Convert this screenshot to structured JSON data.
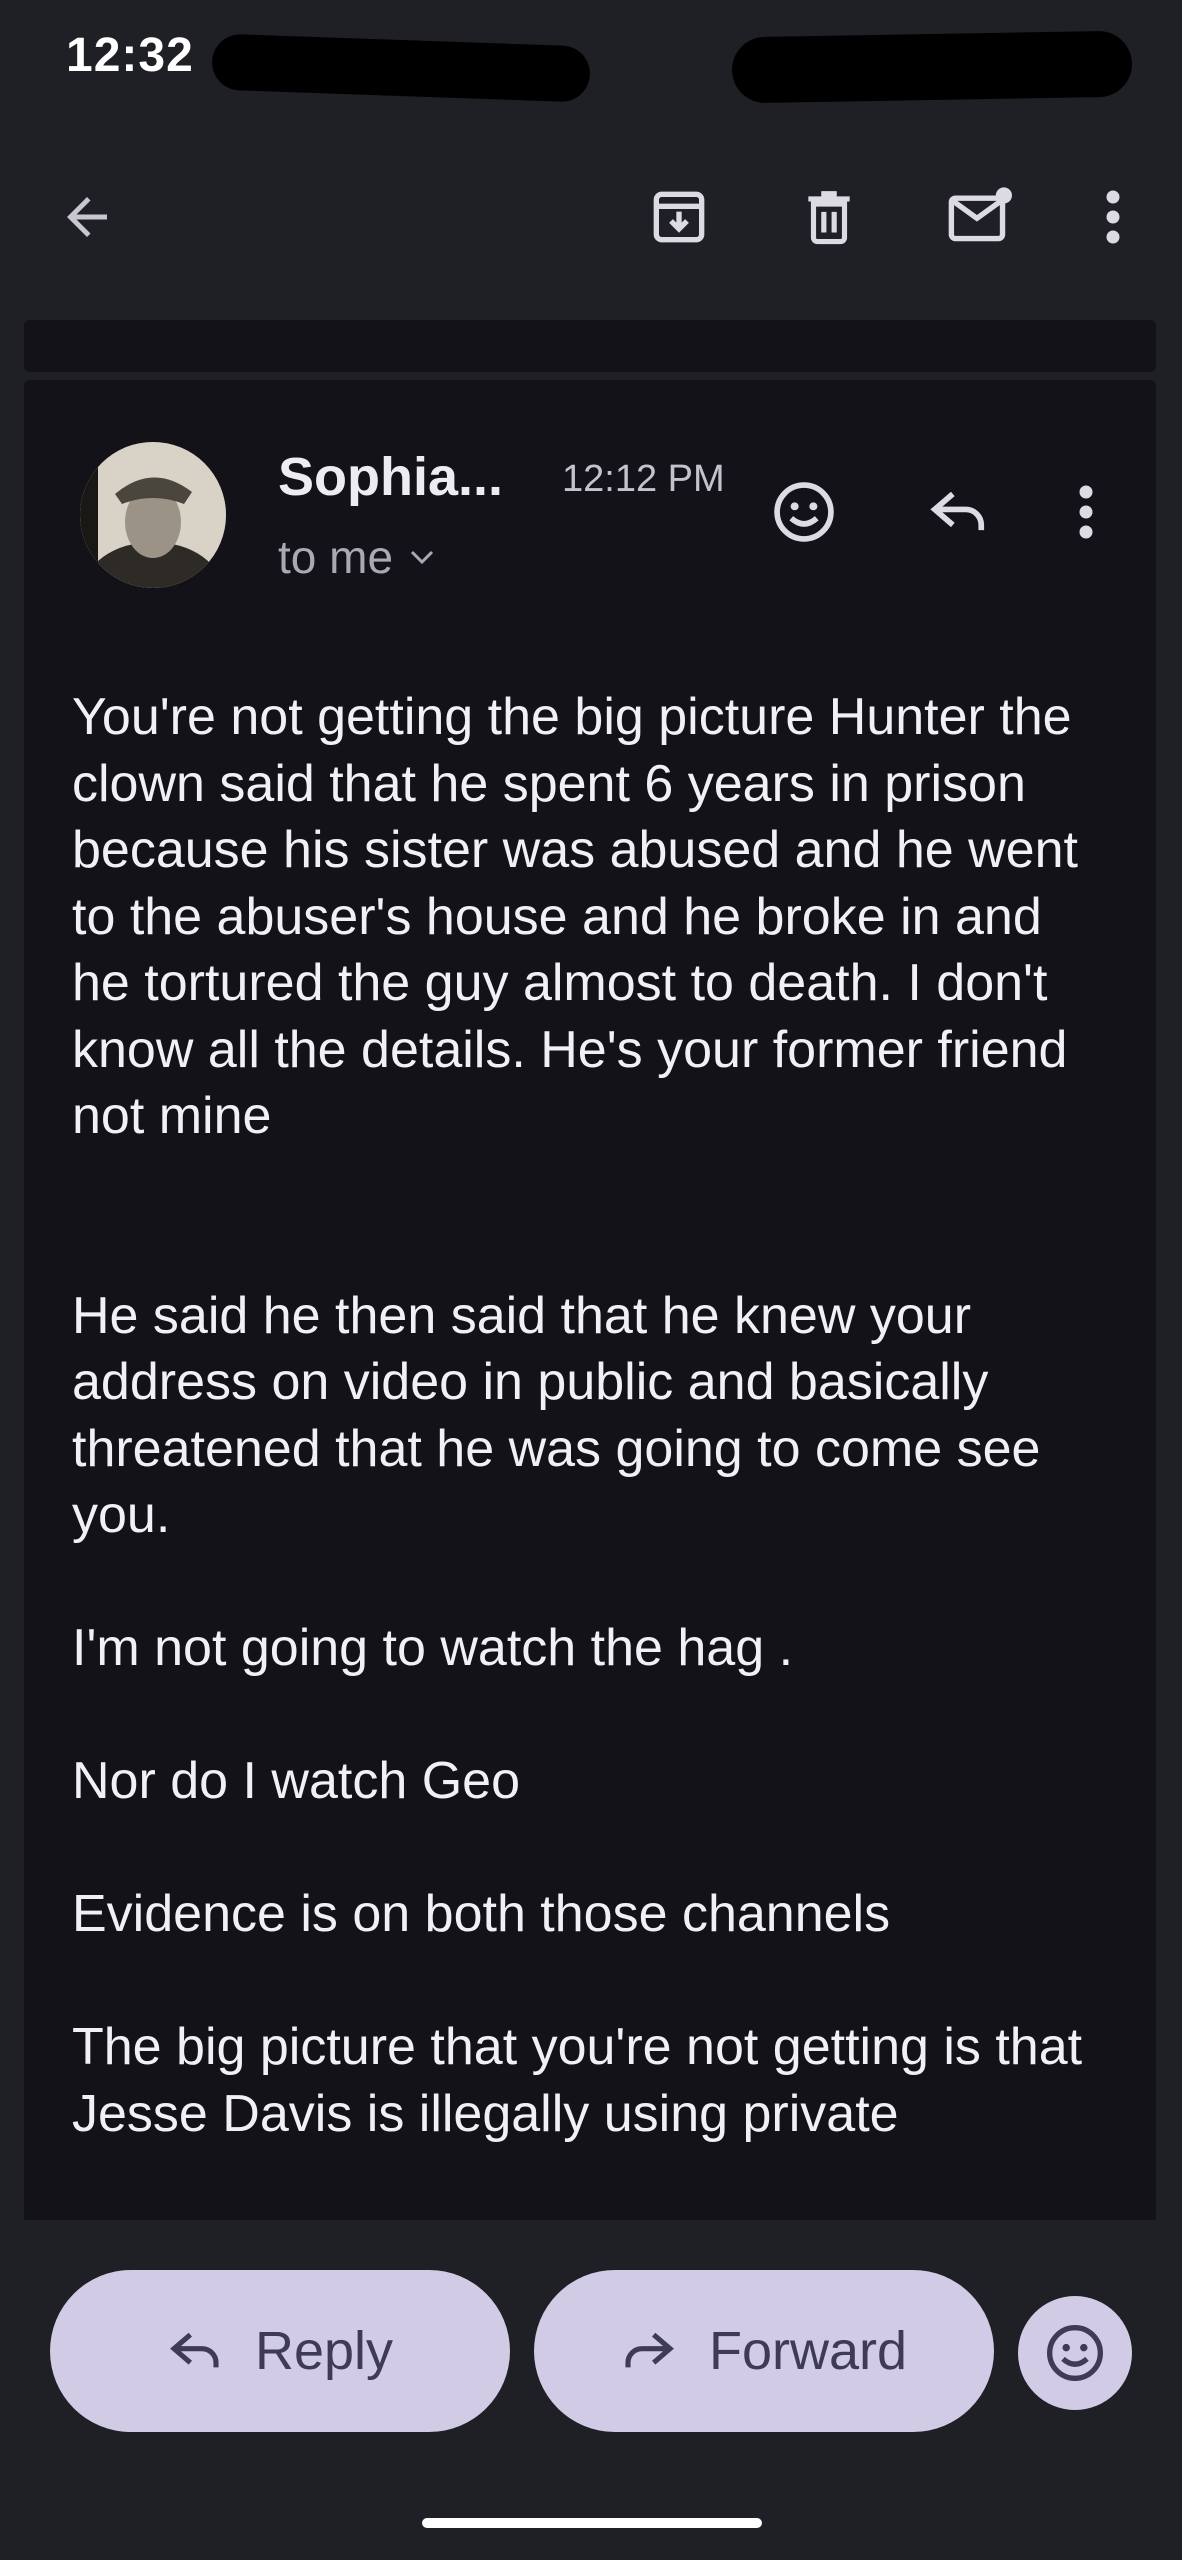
{
  "status_bar": {
    "time": "12:32"
  },
  "toolbar": {
    "back_icon": "arrow-left-icon",
    "archive_icon": "archive-icon",
    "delete_icon": "trash-icon",
    "mark_unread_icon": "mark-unread-icon",
    "more_icon": "more-vertical-icon"
  },
  "message": {
    "sender": "Sophia...",
    "time": "12:12 PM",
    "recipient": "to me",
    "body": [
      "You're not getting the big picture Hunter the clown said that he spent 6 years in prison because his sister was abused and he went to the abuser's house and he broke in and he tortured the guy almost to death. I don't know all the details. He's your former friend not mine",
      "He said he then said that he knew your address on video in public and basically threatened that he was going to come see you.",
      "I'm not going to watch the hag .",
      "Nor do I watch Geo",
      "Evidence is on both those channels",
      "The big picture that you're not getting is that Jesse Davis is illegally using private"
    ]
  },
  "actions": {
    "reply_label": "Reply",
    "forward_label": "Forward"
  },
  "colors": {
    "background": "#1f1f26",
    "card": "#121218",
    "pill": "#d2cbe5",
    "pill_text": "#3f3b55"
  }
}
